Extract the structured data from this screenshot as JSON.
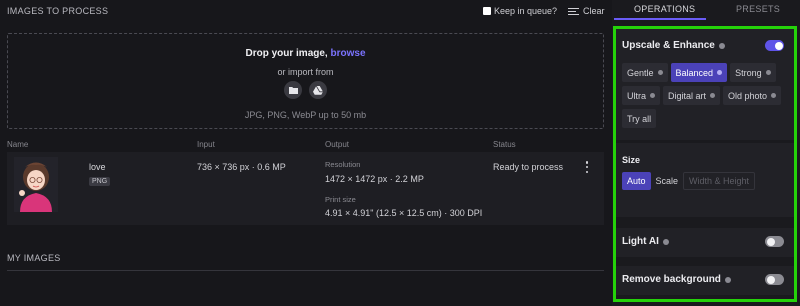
{
  "left": {
    "title": "IMAGES TO PROCESS",
    "keep_label": "Keep in queue?",
    "clear_label": "Clear",
    "drop": {
      "headline": "Drop your image,",
      "browse": "browse",
      "subline": "or import from",
      "formats": "JPG, PNG, WebP up to 50 mb",
      "import_icons": [
        "folder-icon",
        "google-drive-icon"
      ]
    },
    "columns": [
      "Name",
      "Input",
      "Output",
      "Status"
    ],
    "rows": [
      {
        "name": "love",
        "type": "PNG",
        "input": "736 × 736 px · 0.6 MP",
        "resolution_label": "Resolution",
        "resolution": "1472 × 1472 px · 2.2 MP",
        "print_label": "Print size",
        "print": "4.91 × 4.91\" (12.5 × 12.5 cm) · 300 DPI",
        "status": "Ready to process"
      }
    ],
    "my_images": "MY IMAGES"
  },
  "tabs": [
    {
      "label": "OPERATIONS",
      "active": true
    },
    {
      "label": "PRESETS",
      "active": false
    }
  ],
  "operations": {
    "upscale": {
      "title": "Upscale & Enhance",
      "enabled": true,
      "modes": [
        {
          "label": "Gentle",
          "selected": false
        },
        {
          "label": "Balanced",
          "selected": true
        },
        {
          "label": "Strong",
          "selected": false
        },
        {
          "label": "Ultra",
          "selected": false
        },
        {
          "label": "Digital art",
          "selected": false
        },
        {
          "label": "Old photo",
          "selected": false
        },
        {
          "label": "Try all",
          "selected": false
        }
      ]
    },
    "size": {
      "title": "Size",
      "options": [
        "Auto",
        "Scale",
        "Width & Height"
      ],
      "selected": "Auto"
    },
    "light_ai": {
      "title": "Light AI",
      "enabled": false
    },
    "remove_bg": {
      "title": "Remove background",
      "enabled": false
    }
  },
  "colors": {
    "accent": "#5f54e8",
    "highlight_frame": "#25d20a",
    "background": "#17171b"
  }
}
